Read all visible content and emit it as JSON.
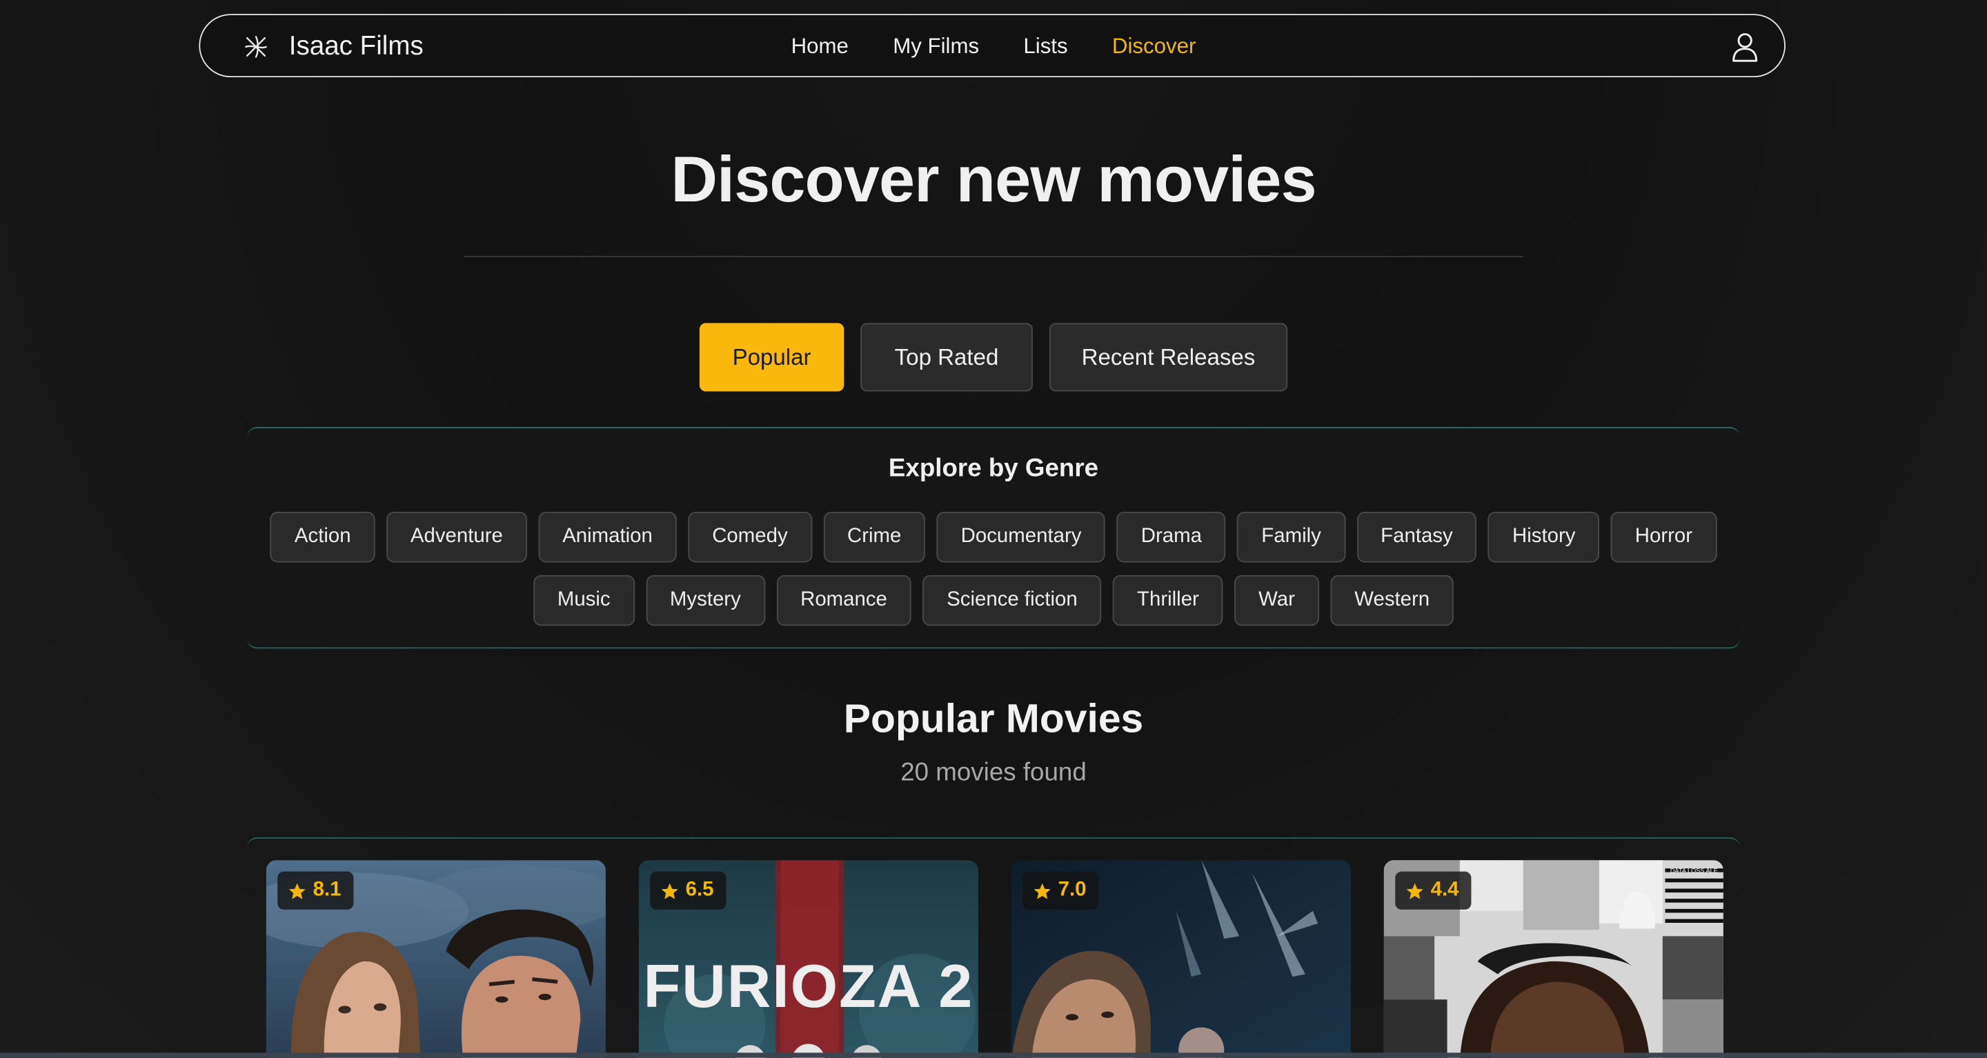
{
  "nav": {
    "brand": "Isaac Films",
    "brand_icon": "film-reel-icon",
    "links": [
      {
        "label": "Home",
        "active": false
      },
      {
        "label": "My Films",
        "active": false
      },
      {
        "label": "Lists",
        "active": false
      },
      {
        "label": "Discover",
        "active": true
      }
    ],
    "profile_icon": "user-icon"
  },
  "hero": {
    "title": "Discover new movies"
  },
  "tabs": [
    {
      "label": "Popular",
      "active": true
    },
    {
      "label": "Top Rated",
      "active": false
    },
    {
      "label": "Recent Releases",
      "active": false
    }
  ],
  "genres": {
    "title": "Explore by Genre",
    "items": [
      "Action",
      "Adventure",
      "Animation",
      "Comedy",
      "Crime",
      "Documentary",
      "Drama",
      "Family",
      "Fantasy",
      "History",
      "Horror",
      "Music",
      "Mystery",
      "Romance",
      "Science fiction",
      "Thriller",
      "War",
      "Western"
    ]
  },
  "results": {
    "title": "Popular Movies",
    "count_text": "20 movies found",
    "movies": [
      {
        "rating": "8.1",
        "poster_text": ""
      },
      {
        "rating": "6.5",
        "poster_text": "FURIOZA 2"
      },
      {
        "rating": "7.0",
        "poster_text": ""
      },
      {
        "rating": "4.4",
        "poster_text": "DATA LOSS ALE"
      }
    ]
  },
  "colors": {
    "accent": "#fbb80c",
    "active_nav": "#f5b800",
    "panel_border": "#1f6f6a",
    "background": "#141414"
  }
}
